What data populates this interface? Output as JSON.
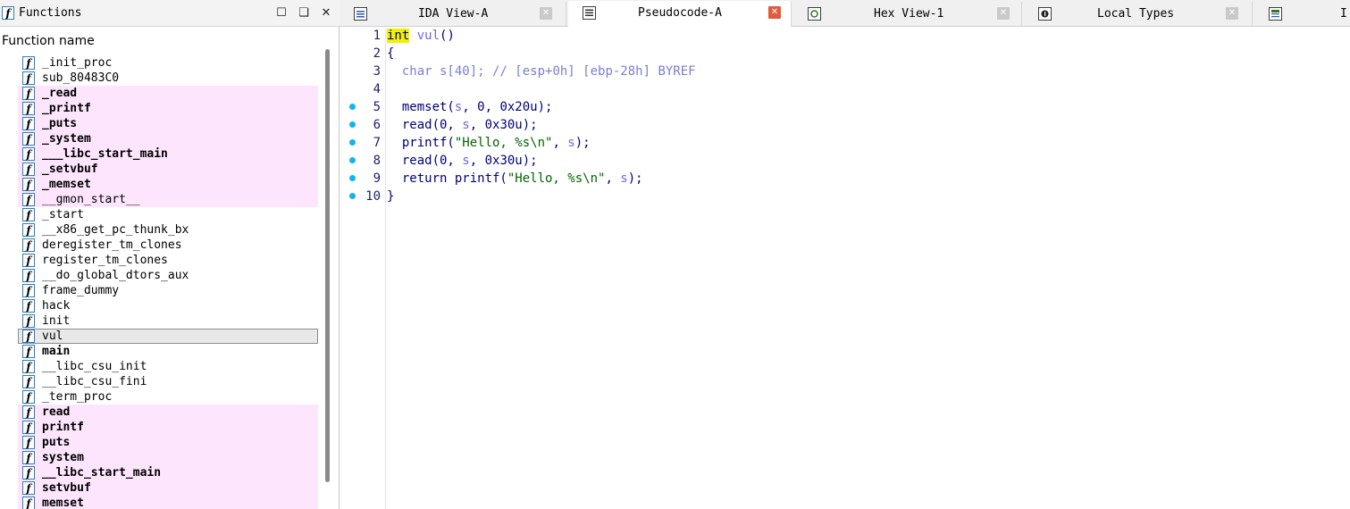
{
  "functions_window": {
    "title": "Functions",
    "column_header": "Function name",
    "functions": [
      {
        "name": "_init_proc",
        "import": false,
        "bold": false,
        "selected": false
      },
      {
        "name": "sub_80483C0",
        "import": false,
        "bold": false,
        "selected": false
      },
      {
        "name": "_read",
        "import": true,
        "bold": true,
        "selected": false
      },
      {
        "name": "_printf",
        "import": true,
        "bold": true,
        "selected": false
      },
      {
        "name": "_puts",
        "import": true,
        "bold": true,
        "selected": false
      },
      {
        "name": "_system",
        "import": true,
        "bold": true,
        "selected": false
      },
      {
        "name": "___libc_start_main",
        "import": true,
        "bold": true,
        "selected": false
      },
      {
        "name": "_setvbuf",
        "import": true,
        "bold": true,
        "selected": false
      },
      {
        "name": "_memset",
        "import": true,
        "bold": true,
        "selected": false
      },
      {
        "name": "__gmon_start__",
        "import": true,
        "bold": false,
        "selected": false
      },
      {
        "name": "_start",
        "import": false,
        "bold": false,
        "selected": false
      },
      {
        "name": "__x86_get_pc_thunk_bx",
        "import": false,
        "bold": false,
        "selected": false
      },
      {
        "name": "deregister_tm_clones",
        "import": false,
        "bold": false,
        "selected": false
      },
      {
        "name": "register_tm_clones",
        "import": false,
        "bold": false,
        "selected": false
      },
      {
        "name": "__do_global_dtors_aux",
        "import": false,
        "bold": false,
        "selected": false
      },
      {
        "name": "frame_dummy",
        "import": false,
        "bold": false,
        "selected": false
      },
      {
        "name": "hack",
        "import": false,
        "bold": false,
        "selected": false
      },
      {
        "name": "init",
        "import": false,
        "bold": false,
        "selected": false
      },
      {
        "name": "vul",
        "import": false,
        "bold": false,
        "selected": true
      },
      {
        "name": "main",
        "import": false,
        "bold": true,
        "selected": false
      },
      {
        "name": "__libc_csu_init",
        "import": false,
        "bold": false,
        "selected": false
      },
      {
        "name": "__libc_csu_fini",
        "import": false,
        "bold": false,
        "selected": false
      },
      {
        "name": "_term_proc",
        "import": false,
        "bold": false,
        "selected": false
      },
      {
        "name": "read",
        "import": true,
        "bold": true,
        "selected": false
      },
      {
        "name": "printf",
        "import": true,
        "bold": true,
        "selected": false
      },
      {
        "name": "puts",
        "import": true,
        "bold": true,
        "selected": false
      },
      {
        "name": "system",
        "import": true,
        "bold": true,
        "selected": false
      },
      {
        "name": "__libc_start_main",
        "import": true,
        "bold": true,
        "selected": false
      },
      {
        "name": "setvbuf",
        "import": true,
        "bold": true,
        "selected": false
      },
      {
        "name": "memset",
        "import": true,
        "bold": true,
        "selected": false
      }
    ]
  },
  "tabs": [
    {
      "label": "IDA View-A",
      "icon": "ida-view-icon",
      "active": false
    },
    {
      "label": "Pseudocode-A",
      "icon": "pseudocode-icon",
      "active": true
    },
    {
      "label": "Hex View-1",
      "icon": "hex-view-icon",
      "active": false
    },
    {
      "label": "Local Types",
      "icon": "local-types-icon",
      "active": false
    },
    {
      "label": "I",
      "icon": "imports-icon",
      "active": false
    }
  ],
  "pseudocode": {
    "lines": [
      {
        "num": "1",
        "dot": false,
        "tokens": [
          {
            "t": "int",
            "c": "kw-int"
          },
          {
            "t": " ",
            "c": ""
          },
          {
            "t": "vul",
            "c": "tok-var"
          },
          {
            "t": "()",
            "c": ""
          }
        ]
      },
      {
        "num": "2",
        "dot": false,
        "tokens": [
          {
            "t": "{",
            "c": ""
          }
        ]
      },
      {
        "num": "3",
        "dot": false,
        "tokens": [
          {
            "t": "  char s[40]; ",
            "c": "tok-comment"
          },
          {
            "t": "// [esp+0h] [ebp-28h] BYREF",
            "c": "tok-comment"
          }
        ]
      },
      {
        "num": "4",
        "dot": false,
        "tokens": []
      },
      {
        "num": "5",
        "dot": true,
        "tokens": [
          {
            "t": "  memset(",
            "c": ""
          },
          {
            "t": "s",
            "c": "tok-var"
          },
          {
            "t": ", 0, 0x20u);",
            "c": ""
          }
        ]
      },
      {
        "num": "6",
        "dot": true,
        "tokens": [
          {
            "t": "  read(0, ",
            "c": ""
          },
          {
            "t": "s",
            "c": "tok-var"
          },
          {
            "t": ", 0x30u);",
            "c": ""
          }
        ]
      },
      {
        "num": "7",
        "dot": true,
        "tokens": [
          {
            "t": "  printf(",
            "c": ""
          },
          {
            "t": "\"Hello, %s\\n\"",
            "c": "tok-str"
          },
          {
            "t": ", ",
            "c": ""
          },
          {
            "t": "s",
            "c": "tok-var"
          },
          {
            "t": ");",
            "c": ""
          }
        ]
      },
      {
        "num": "8",
        "dot": true,
        "tokens": [
          {
            "t": "  read(0, ",
            "c": ""
          },
          {
            "t": "s",
            "c": "tok-var"
          },
          {
            "t": ", 0x30u);",
            "c": ""
          }
        ]
      },
      {
        "num": "9",
        "dot": true,
        "tokens": [
          {
            "t": "  return printf(",
            "c": ""
          },
          {
            "t": "\"Hello, %s\\n\"",
            "c": "tok-str"
          },
          {
            "t": ", ",
            "c": ""
          },
          {
            "t": "s",
            "c": "tok-var"
          },
          {
            "t": ");",
            "c": ""
          }
        ]
      },
      {
        "num": "10",
        "dot": true,
        "tokens": [
          {
            "t": "}",
            "c": ""
          }
        ]
      }
    ]
  },
  "colors": {
    "import_row_bg": "#fde6fd",
    "selected_row_bg": "#e8e8e8",
    "int_highlight": "#f0f000",
    "breakpoint_dot": "#10b5ee",
    "active_tab_close": "#e15b3c"
  }
}
